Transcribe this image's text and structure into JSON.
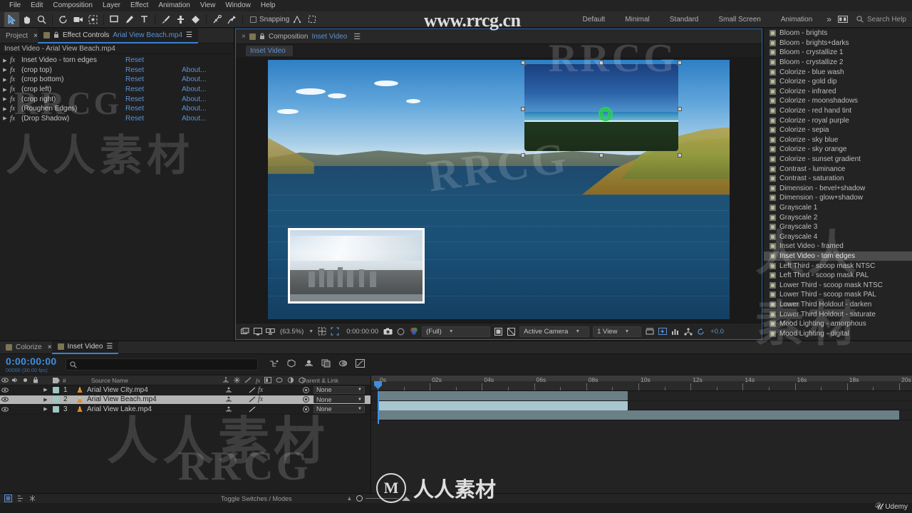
{
  "menu": {
    "items": [
      "File",
      "Edit",
      "Composition",
      "Layer",
      "Effect",
      "Animation",
      "View",
      "Window",
      "Help"
    ]
  },
  "toolbar": {
    "snapping_label": "Snapping",
    "workspaces": [
      "Default",
      "Minimal",
      "Standard",
      "Small Screen",
      "Animation"
    ],
    "overflow_label": "»",
    "search_help": "Search Help"
  },
  "effect_controls": {
    "tab_project": "Project",
    "tab_effect_controls": "Effect Controls",
    "tab_effect_controls_item": "Arial View Beach.mp4",
    "subtitle": "Inset Video - Arial View Beach.mp4",
    "reset_label": "Reset",
    "about_label": "About...",
    "effects": [
      {
        "name": "Inset Video - torn edges",
        "reset": "Reset",
        "about": ""
      },
      {
        "name": "(crop top)",
        "reset": "Reset",
        "about": "About..."
      },
      {
        "name": "(crop bottom)",
        "reset": "Reset",
        "about": "About..."
      },
      {
        "name": "(crop left)",
        "reset": "Reset",
        "about": "About..."
      },
      {
        "name": "(crop right)",
        "reset": "Reset",
        "about": "About..."
      },
      {
        "name": "(Roughen Edges)",
        "reset": "Reset",
        "about": "About..."
      },
      {
        "name": "(Drop Shadow)",
        "reset": "Reset",
        "about": "About..."
      }
    ]
  },
  "composition": {
    "header_label": "Composition",
    "comp_name": "Inset Video",
    "breadcrumb_tab": "Inset Video",
    "viewer_bar": {
      "zoom": "(63.5%)",
      "timecode": "0:00:00:00",
      "resolution": "(Full)",
      "camera": "Active Camera",
      "views": "1 View",
      "exposure": "+0.0"
    }
  },
  "effects_presets": {
    "items": [
      "Bloom - brights",
      "Bloom - brights+darks",
      "Bloom - crystallize 1",
      "Bloom - crystallize 2",
      "Colorize - blue wash",
      "Colorize - gold dip",
      "Colorize - infrared",
      "Colorize - moonshadows",
      "Colorize - red hand tint",
      "Colorize - royal purple",
      "Colorize - sepia",
      "Colorize - sky blue",
      "Colorize - sky orange",
      "Colorize - sunset gradient",
      "Contrast - luminance",
      "Contrast - saturation",
      "Dimension - bevel+shadow",
      "Dimension - glow+shadow",
      "Grayscale 1",
      "Grayscale 2",
      "Grayscale 3",
      "Grayscale 4",
      "Inset Video - framed",
      "Inset Video - torn edges",
      "Left Third - scoop mask NTSC",
      "Left Third - scoop mask PAL",
      "Lower Third - scoop mask NTSC",
      "Lower Third - scoop mask PAL",
      "Lower Third Holdout - darken",
      "Lower Third Holdout - saturate",
      "Mood Lighting - amorphous",
      "Mood Lighting - digital"
    ],
    "selected": "Inset Video - torn edges"
  },
  "timeline": {
    "tab_inactive": "Colorize",
    "tab_active": "Inset Video",
    "timecode": "0:00:00:00",
    "timecode_sub": "00000 (30.00 fps)",
    "search_placeholder": "",
    "columns": {
      "source_name": "Source Name",
      "parent_link": "Parent & Link",
      "index": "#"
    },
    "layers": [
      {
        "index": "1",
        "name": "Arial View City.mp4",
        "parent": "None",
        "has_fx": true,
        "selected": false,
        "clip_color": "#6a7f86",
        "clip_start_pct": 0,
        "clip_end_pct": 48
      },
      {
        "index": "2",
        "name": "Arial View Beach.mp4",
        "parent": "None",
        "has_fx": true,
        "selected": true,
        "clip_color": "#a8c6cf",
        "clip_start_pct": 0,
        "clip_end_pct": 48
      },
      {
        "index": "3",
        "name": "Arial View Lake.mp4",
        "parent": "None",
        "has_fx": false,
        "selected": false,
        "clip_color": "#6a7f86",
        "clip_start_pct": 0,
        "clip_end_pct": 100
      }
    ],
    "ruler_labels": [
      "0s",
      "02s",
      "04s",
      "06s",
      "08s",
      "10s",
      "12s",
      "14s",
      "16s",
      "18s",
      "20s"
    ],
    "footer_label": "Toggle Switches / Modes"
  },
  "branding": {
    "udemy": "Udemy",
    "watermark_url": "www.rrcg.cn",
    "watermark_rrcg": "RRCG",
    "watermark_cjk_left": "人人素材",
    "watermark_cjk_center": "人人素材",
    "watermark_center_mark": "M"
  },
  "colors": {
    "accent_blue": "#3f8ede",
    "link_blue": "#5b92d6",
    "panel_bg": "#1f1f1f",
    "panel_header": "#282828",
    "selection": "#4c4c4c",
    "anchor_green": "#2ad34a"
  }
}
